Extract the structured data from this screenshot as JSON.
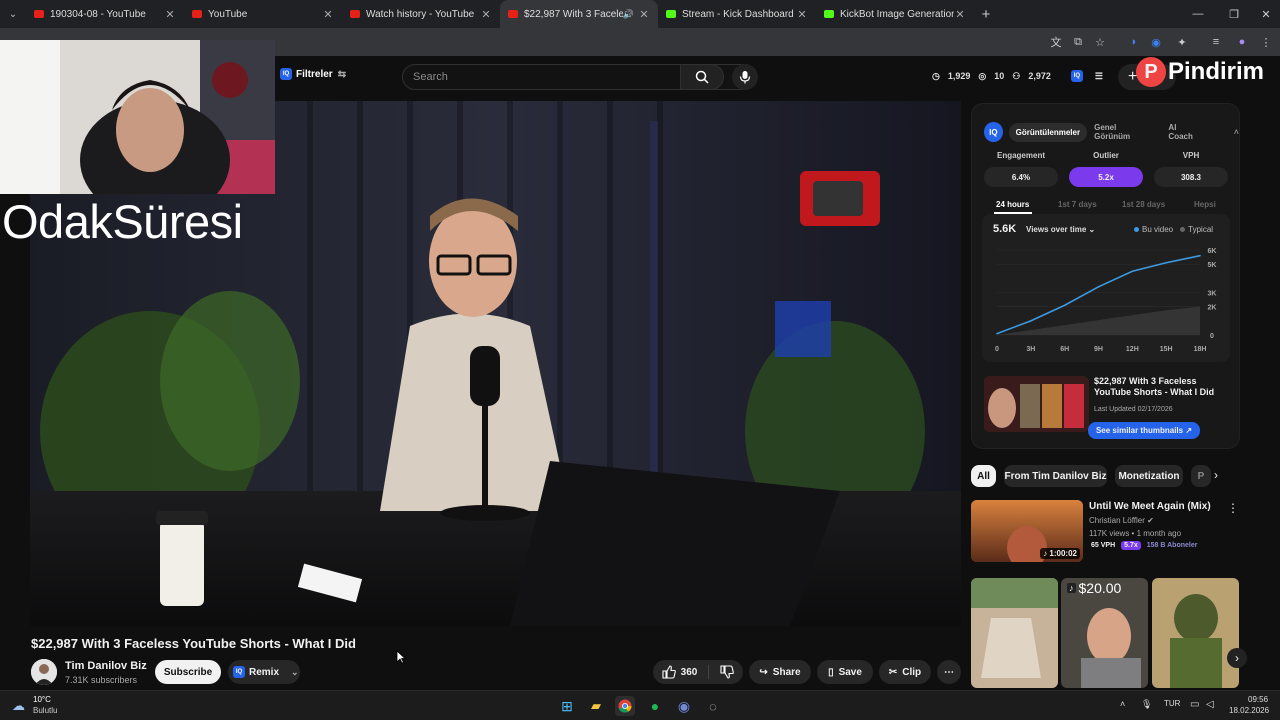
{
  "tabs": [
    {
      "title": "190304-08 - YouTube",
      "icon": "youtube-icon",
      "active": false
    },
    {
      "title": "YouTube",
      "icon": "youtube-icon",
      "active": false
    },
    {
      "title": "Watch history - YouTube",
      "icon": "youtube-icon",
      "active": false
    },
    {
      "title": "$22,987 With 3 Faceless Yo",
      "icon": "youtube-icon",
      "active": true
    },
    {
      "title": "Stream - Kick Dashboard",
      "icon": "kick-icon",
      "active": false
    },
    {
      "title": "KickBot Image Generation",
      "icon": "kickbot-icon",
      "active": false
    }
  ],
  "header": {
    "filters_label": "Filtreler",
    "search_placeholder": "Search",
    "stats": {
      "views": "1,929",
      "eye": "10",
      "subs": "2,972"
    }
  },
  "overlay": {
    "webcam_text": "OdakSüresi",
    "brand": "Pindirim"
  },
  "video": {
    "title": "$22,987 With 3 Faceless YouTube Shorts - What I Did",
    "channel": "Tim Danilov Biz",
    "subscribers": "7.31K subscribers",
    "subscribe_label": "Subscribe",
    "remix_label": "Remix",
    "likes": "360",
    "share_label": "Share",
    "save_label": "Save",
    "clip_label": "Clip"
  },
  "panel": {
    "tabs": [
      "Görüntülenmeler",
      "Genel Görünüm",
      "AI Coach"
    ],
    "metrics": [
      {
        "label": "Engagement",
        "value": "6.4%"
      },
      {
        "label": "Outlier",
        "value": "5.2x"
      },
      {
        "label": "VPH",
        "value": "308.3"
      }
    ],
    "periods": [
      "24 hours",
      "1st 7 days",
      "1st 28 days",
      "Hepsi"
    ],
    "chart_total": "5.6K",
    "chart_mode": "Views over time",
    "legend_this": "Bu video",
    "legend_typical": "Typical",
    "thumb_title": "$22,987 With 3 Faceless YouTube Shorts - What I Did",
    "last_updated": "Last Updated 02/17/2026",
    "similar_label": "See similar thumbnails"
  },
  "chart_data": {
    "type": "area",
    "x": [
      "0",
      "3H",
      "6H",
      "9H",
      "12H",
      "15H",
      "18H"
    ],
    "series": [
      {
        "name": "Bu video",
        "values": [
          0.1,
          1.0,
          2.1,
          3.4,
          4.5,
          5.1,
          5.6
        ]
      },
      {
        "name": "Typical",
        "values": [
          0,
          0.35,
          0.7,
          1.05,
          1.4,
          1.75,
          2.0
        ]
      }
    ],
    "y_ticks": [
      "6K",
      "5K",
      "3K",
      "2K",
      "0"
    ],
    "ylim": [
      0,
      6
    ],
    "colors": {
      "Bu video": "#3b9ae1",
      "Typical": "#555555"
    }
  },
  "chips": [
    "All",
    "From Tim Danilov Biz",
    "Monetization",
    "P"
  ],
  "recommended": {
    "title": "Until We Meet Again (Mix)",
    "channel": "Christian Löffler",
    "meta": "117K views • 1 month ago",
    "duration": "1:00:02",
    "vph": "65 VPH",
    "outlier": "5.7x",
    "subs": "158 B Aboneler"
  },
  "shorts": {
    "price": "$20.00"
  },
  "taskbar": {
    "temp": "10°C",
    "weather": "Bulutlu",
    "lang": "TUR",
    "time": "09:56",
    "date": "18.02.2026"
  }
}
